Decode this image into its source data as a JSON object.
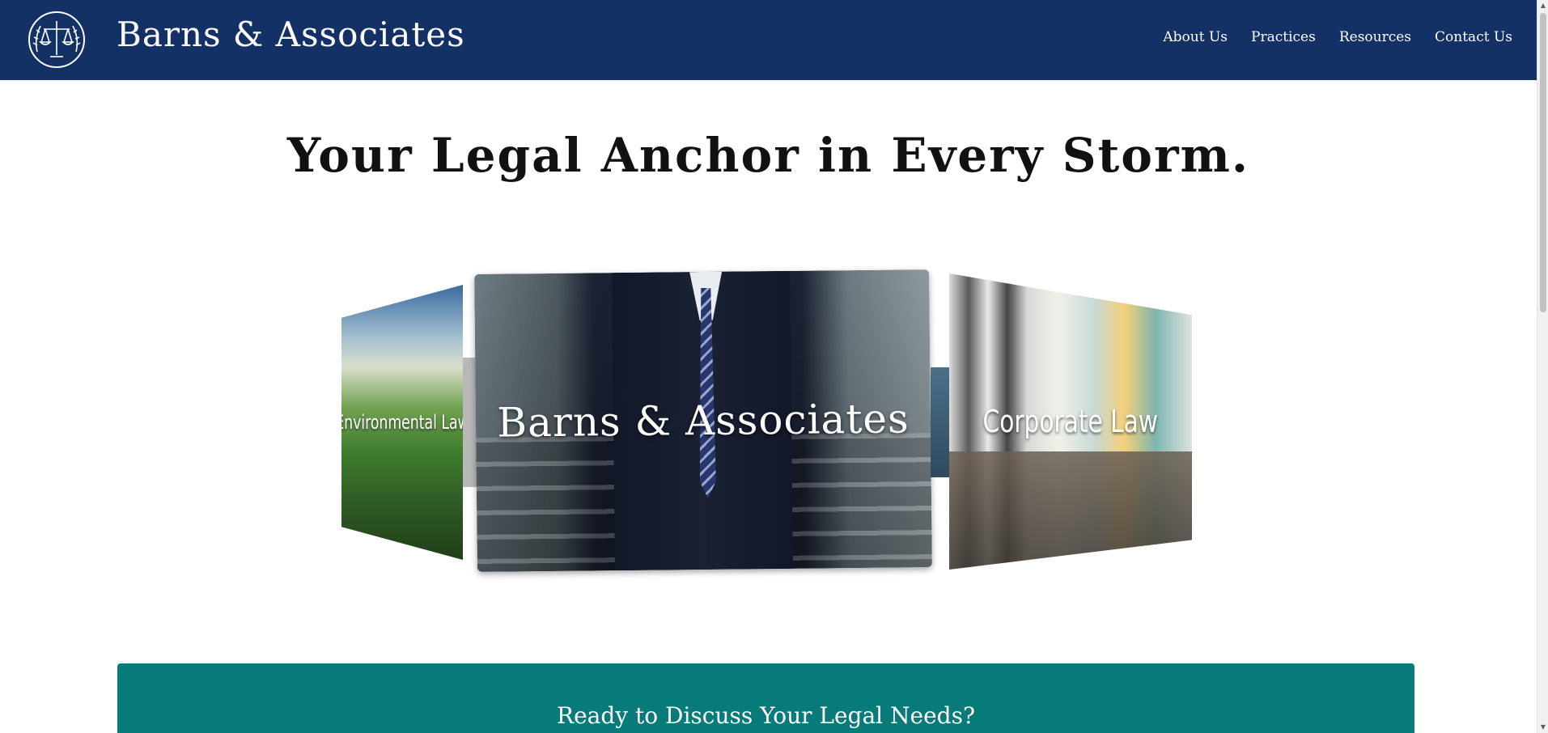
{
  "header": {
    "brand": "Barns & Associates",
    "logo_icon": "scales-of-justice-laurel-icon",
    "nav": [
      "About Us",
      "Practices",
      "Resources",
      "Contact Us"
    ],
    "background": "#143166"
  },
  "hero": {
    "title": "Your Legal Anchor in Every Storm."
  },
  "carousel": {
    "left_card": "Environmental Law",
    "center_card": "Barns & Associates",
    "right_card": "Corporate Law"
  },
  "cta": {
    "heading": "Ready to Discuss Your Legal Needs?",
    "background": "#077a7a"
  },
  "scrollbar": {
    "up_icon": "arrow-up-icon",
    "down_icon": "arrow-down-icon"
  }
}
